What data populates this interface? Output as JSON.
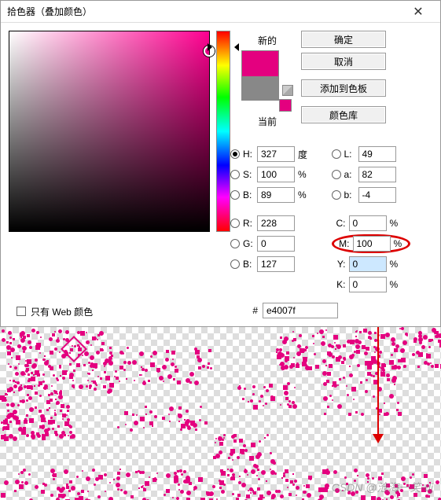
{
  "title": "拾色器（叠加颜色）",
  "close_glyph": "✕",
  "swatch": {
    "new_label": "新的",
    "current_label": "当前"
  },
  "buttons": {
    "ok": "确定",
    "cancel": "取消",
    "add": "添加到色板",
    "lib": "颜色库"
  },
  "hsb": {
    "h": {
      "label": "H:",
      "value": "327",
      "unit": "度"
    },
    "s": {
      "label": "S:",
      "value": "100",
      "unit": "%"
    },
    "b": {
      "label": "B:",
      "value": "89",
      "unit": "%"
    }
  },
  "lab": {
    "l": {
      "label": "L:",
      "value": "49"
    },
    "a": {
      "label": "a:",
      "value": "82"
    },
    "b": {
      "label": "b:",
      "value": "-4"
    }
  },
  "rgb": {
    "r": {
      "label": "R:",
      "value": "228"
    },
    "g": {
      "label": "G:",
      "value": "0"
    },
    "b": {
      "label": "B:",
      "value": "127"
    }
  },
  "cmyk": {
    "c": {
      "label": "C:",
      "value": "0",
      "unit": "%"
    },
    "m": {
      "label": "M:",
      "value": "100",
      "unit": "%"
    },
    "y": {
      "label": "Y:",
      "value": "0",
      "unit": "%"
    },
    "k": {
      "label": "K:",
      "value": "0",
      "unit": "%"
    }
  },
  "hex": {
    "hash": "#",
    "value": "e4007f"
  },
  "web_only": "只有 Web 颜色",
  "watermark": "CSDN @沧海一笑-dj",
  "colors": {
    "picked": "#e4007f",
    "arrow": "#d00"
  }
}
